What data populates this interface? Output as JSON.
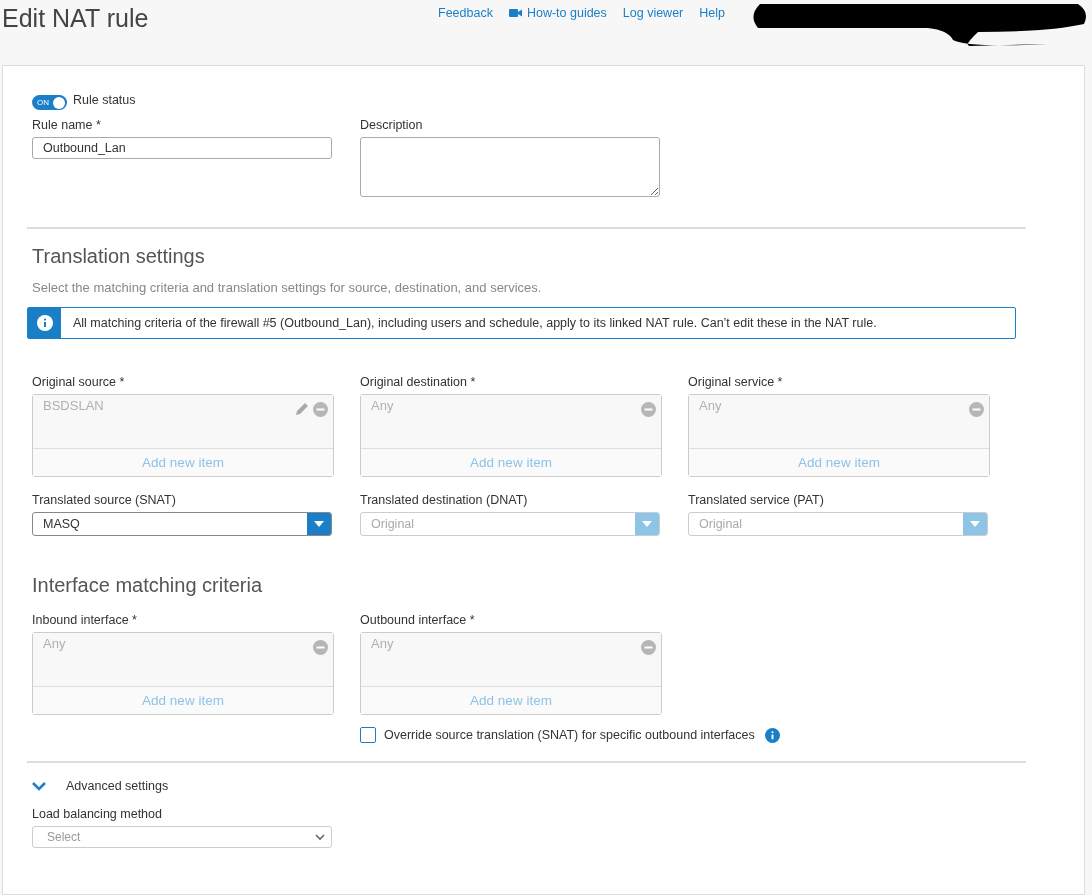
{
  "header": {
    "title": "Edit NAT rule",
    "links": [
      {
        "label": "Feedback",
        "kind": "text"
      },
      {
        "label": "How-to guides",
        "kind": "video"
      },
      {
        "label": "Log viewer",
        "kind": "text"
      },
      {
        "label": "Help",
        "kind": "text"
      }
    ]
  },
  "rule_status": {
    "toggle_text": "ON",
    "on": true,
    "label": "Rule status"
  },
  "rule_name": {
    "label": "Rule name *",
    "value": "Outbound_Lan"
  },
  "description": {
    "label": "Description"
  },
  "translation": {
    "heading": "Translation settings",
    "subtitle": "Select the matching criteria and translation settings for source, destination, and services.",
    "notice": "All matching criteria of the firewall #5 (Outbound_Lan), including users and schedule, apply to its linked NAT rule. Can’t edit these in the NAT rule."
  },
  "original": [
    {
      "label": "Original source *",
      "item": "BSDSLAN",
      "editable": true,
      "add": "Add new item"
    },
    {
      "label": "Original destination *",
      "item": "Any",
      "editable": false,
      "add": "Add new item"
    },
    {
      "label": "Original service *",
      "item": "Any",
      "editable": false,
      "add": "Add new item"
    }
  ],
  "translated": [
    {
      "label": "Translated source (SNAT)",
      "value": "MASQ",
      "disabled": false
    },
    {
      "label": "Translated destination (DNAT)",
      "value": "Original",
      "disabled": true
    },
    {
      "label": "Translated service (PAT)",
      "value": "Original",
      "disabled": true
    }
  ],
  "interface": {
    "heading": "Interface matching criteria",
    "boxes": [
      {
        "label": "Inbound interface *",
        "item": "Any",
        "editable": false,
        "add": "Add new item"
      },
      {
        "label": "Outbound interface *",
        "item": "Any",
        "editable": false,
        "add": "Add new item"
      }
    ],
    "override": {
      "label": "Override source translation (SNAT) for specific outbound interfaces",
      "checked": false
    }
  },
  "advanced": {
    "label": "Advanced settings",
    "expanded": true,
    "load_balancing": {
      "label": "Load balancing method",
      "placeholder": "Select"
    }
  }
}
